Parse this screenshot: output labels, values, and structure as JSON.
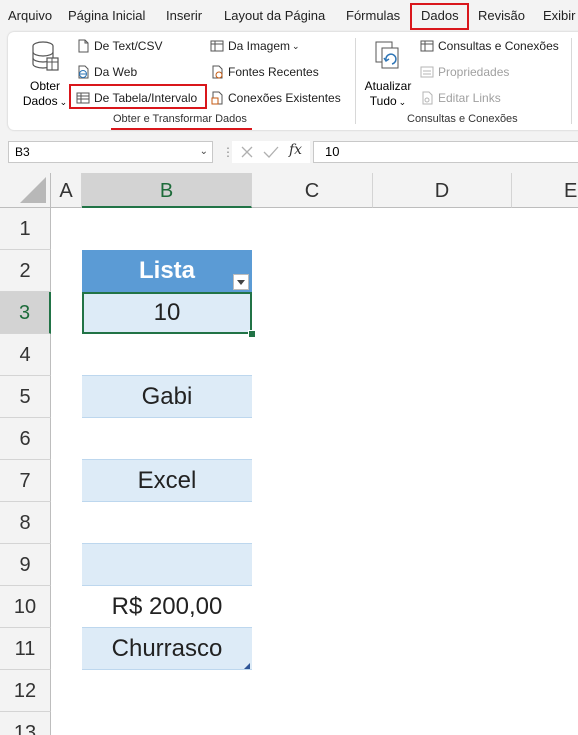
{
  "menu": {
    "tabs": [
      "Arquivo",
      "Página Inicial",
      "Inserir",
      "Layout da Página",
      "Fórmulas",
      "Dados",
      "Revisão",
      "Exibir"
    ],
    "active_tab": "Dados"
  },
  "ribbon": {
    "get_data": {
      "line1": "Obter",
      "line2": "Dados"
    },
    "from_text_csv": "De Text/CSV",
    "from_web": "Da Web",
    "from_table_range": "De Tabela/Intervalo",
    "from_picture": "Da Imagem",
    "recent_sources": "Fontes Recentes",
    "existing_connections": "Conexões Existentes",
    "group_get_transform": "Obter e Transformar Dados",
    "refresh_all": {
      "line1": "Atualizar",
      "line2": "Tudo"
    },
    "queries_connections": "Consultas e Conexões",
    "properties": "Propriedades",
    "edit_links": "Editar Links",
    "group_queries": "Consultas e Conexões"
  },
  "formula_bar": {
    "name_box": "B3",
    "fx": "fx",
    "value": "10"
  },
  "sheet": {
    "columns": [
      "A",
      "B",
      "C",
      "D",
      "E"
    ],
    "rows": [
      "1",
      "2",
      "3",
      "4",
      "5",
      "6",
      "7",
      "8",
      "9",
      "10",
      "11",
      "12",
      "13"
    ],
    "table_header": "Lista",
    "cells": [
      "10",
      "",
      "Gabi",
      "",
      "Excel",
      "",
      "",
      "R$ 200,00",
      "Churrasco"
    ]
  },
  "colors": {
    "table_header": "#5b9bd5",
    "band": "#ddebf7",
    "highlight": "#d9161b",
    "selection": "#217346"
  }
}
